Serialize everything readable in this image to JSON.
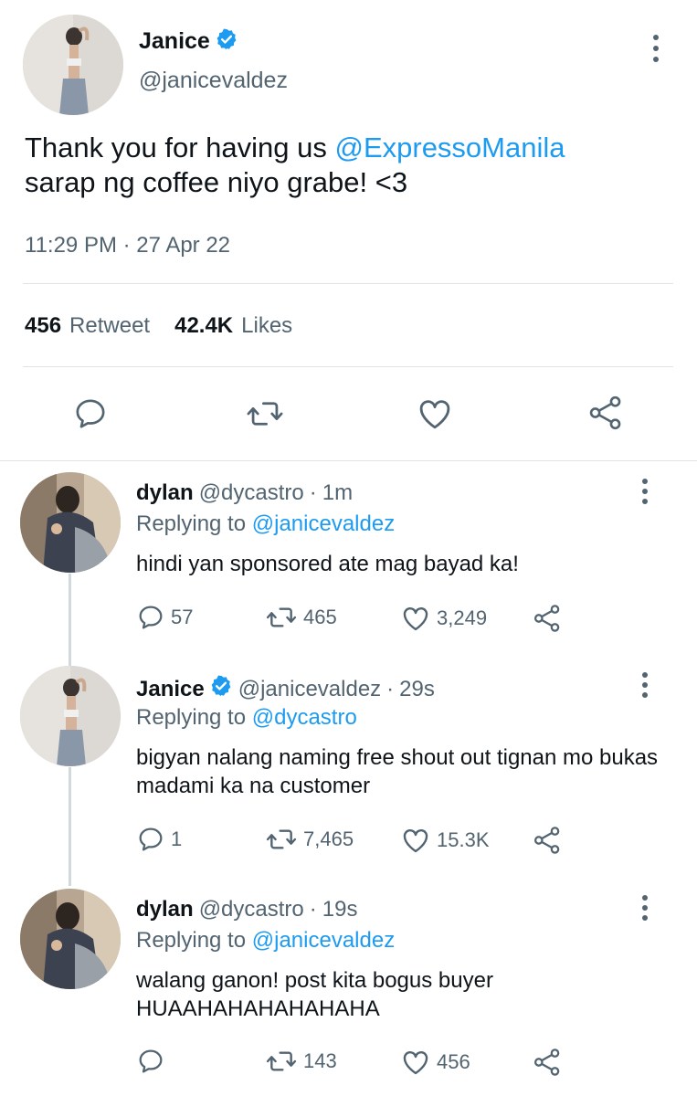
{
  "main_tweet": {
    "name": "Janice",
    "handle": "@janicevaldez",
    "text_before": "Thank you for having us ",
    "mention": "@ExpressoManila",
    "text_after": "sarap ng coffee niyo grabe! <3",
    "timestamp": "11:29 PM · 27 Apr 22",
    "retweets_count": "456",
    "retweets_label": "Retweet",
    "likes_count": "42.4K",
    "likes_label": "Likes"
  },
  "replies": [
    {
      "name": "dylan",
      "handle": "@dycastro",
      "separator": "·",
      "time": "1m",
      "replying_label": "Replying to",
      "replying_to": "@janicevaldez",
      "text": "hindi yan sponsored ate mag bayad ka!",
      "reply_count": "57",
      "retweet_count": "465",
      "like_count": "3,249"
    },
    {
      "name": "Janice",
      "handle": "@janicevaldez",
      "separator": "·",
      "time": "29s",
      "replying_label": "Replying to",
      "replying_to": "@dycastro",
      "text": "bigyan nalang naming free shout out tignan mo bukas madami ka na customer",
      "reply_count": "1",
      "retweet_count": "7,465",
      "like_count": "15.3K"
    },
    {
      "name": "dylan",
      "handle": "@dycastro",
      "separator": "·",
      "time": "19s",
      "replying_label": "Replying to",
      "replying_to": "@janicevaldez",
      "text": "walang ganon! post kita bogus buyer HUAAHAHAHAHAHAHA",
      "reply_count": "",
      "retweet_count": "143",
      "like_count": "456"
    }
  ],
  "colors": {
    "link": "#1d9bf0",
    "secondary_text": "#536471",
    "primary_text": "#0f1419",
    "divider": "#dfe3e6",
    "verified_badge": "#1d9bf0"
  },
  "icons": {
    "reply": "speech-bubble-icon",
    "retweet": "retweet-arrows-icon",
    "like": "heart-icon",
    "share": "share-nodes-icon",
    "more": "vertical-dots-icon",
    "verified": "verified-badge-icon"
  }
}
